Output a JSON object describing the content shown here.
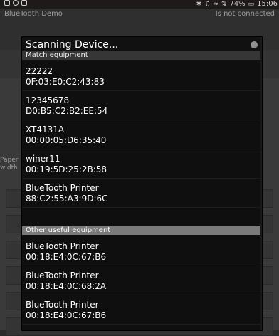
{
  "statusbar": {
    "time": "15:06",
    "battery": "74%",
    "icons": [
      "gallery-icon",
      "circle-icon",
      "shield-icon",
      "bluetooth-icon",
      "mute-icon",
      "wifi-icon",
      "data-icon",
      "battery-icon"
    ]
  },
  "appbar": {
    "title": "BlueTooth Demo",
    "connection_status": "Is not connected"
  },
  "background": {
    "paper_label": "Paper\nwidth"
  },
  "dialog": {
    "title": "Scanning Device...",
    "match_header": "Match equipment",
    "other_header": "Other useful equipment",
    "matched_devices": [
      {
        "name": "22222",
        "mac": "0F:03:E0:C2:43:83"
      },
      {
        "name": "12345678",
        "mac": "D0:B5:C2:B2:EE:54"
      },
      {
        "name": "XT4131A",
        "mac": "00:00:05:D6:35:40"
      },
      {
        "name": "winer11",
        "mac": "00:19:5D:25:2B:58"
      },
      {
        "name": "BlueTooth Printer",
        "mac": "88:C2:55:A3:9D:6C"
      }
    ],
    "other_devices": [
      {
        "name": "BlueTooth Printer",
        "mac": "00:18:E4:0C:67:B6"
      },
      {
        "name": "BlueTooth Printer",
        "mac": "00:18:E4:0C:68:2A"
      },
      {
        "name": "BlueTooth Printer",
        "mac": "00:18:E4:0C:67:B6"
      }
    ]
  }
}
